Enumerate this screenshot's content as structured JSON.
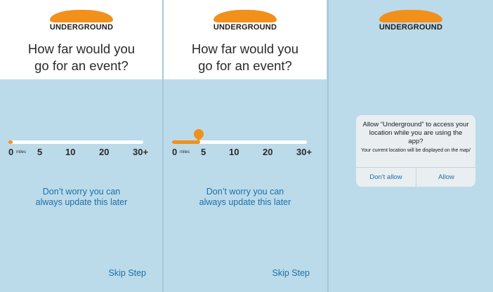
{
  "brand": {
    "name": "UNDERGROUND",
    "accent_color": "#f2901c",
    "link_color": "#1b6fa8"
  },
  "question": {
    "line1": "How far would you",
    "line2": "go for an event?"
  },
  "distance_options": {
    "unit": "miles",
    "labels": [
      "0",
      "5",
      "10",
      "20",
      "30+"
    ]
  },
  "screens": [
    {
      "slider_fraction": 0.0
    },
    {
      "slider_fraction": 0.2,
      "selected_label": "5"
    },
    {
      "permission_dialog": true
    }
  ],
  "reassurance": {
    "line1": "Don’t worry you can",
    "line2": "always update this later"
  },
  "skip_label": "Skip Step",
  "permission_dialog": {
    "title": "Allow “Underground” to access your location while you are using the app?",
    "message": "Your current location will be displayed on the map/",
    "deny_label": "Don't allow",
    "allow_label": "Allow"
  }
}
